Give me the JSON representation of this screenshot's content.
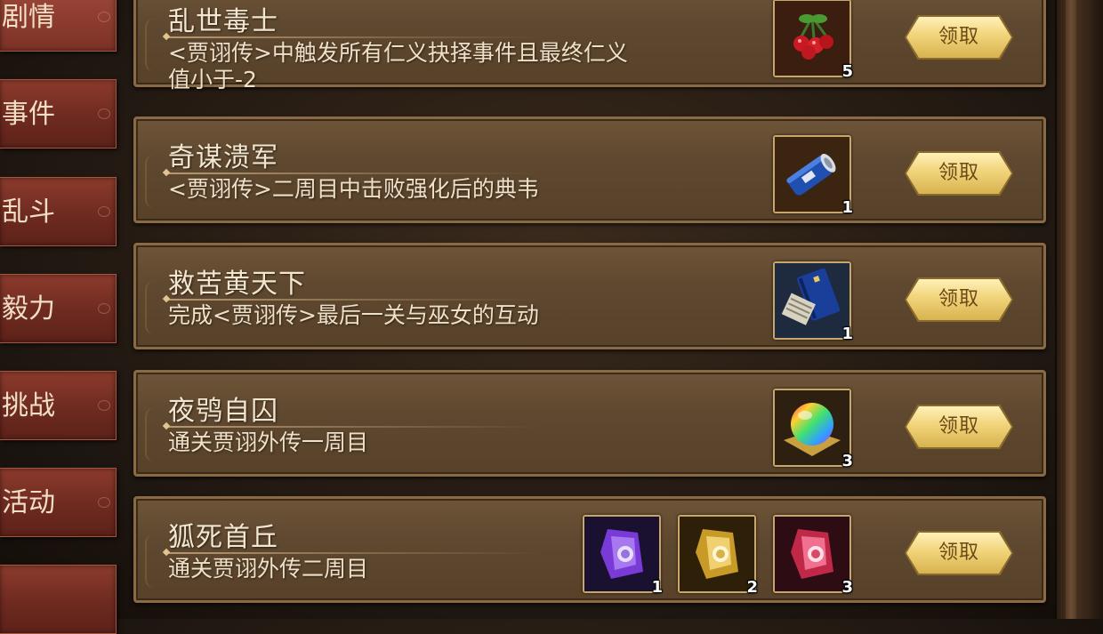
{
  "tabs": [
    {
      "label": "剧情",
      "active": true
    },
    {
      "label": "事件",
      "active": false
    },
    {
      "label": "乱斗",
      "active": false
    },
    {
      "label": "毅力",
      "active": false
    },
    {
      "label": "挑战",
      "active": false
    },
    {
      "label": "活动",
      "active": false
    },
    {
      "label": "",
      "active": false
    }
  ],
  "achievements": [
    {
      "title": "乱世毒士",
      "description": "<贾诩传>中触发所有仁义抉择事件且最终仁义值小于-2",
      "claim_label": "领取",
      "rewards": [
        {
          "icon": "cherry-icon",
          "count": "5"
        }
      ]
    },
    {
      "title": "奇谋溃军",
      "description": "<贾诩传>二周目中击败强化后的典韦",
      "claim_label": "领取",
      "rewards": [
        {
          "icon": "blue-scroll-icon",
          "count": "1"
        }
      ]
    },
    {
      "title": "救苦黄天下",
      "description": "完成<贾诩传>最后一关与巫女的互动",
      "claim_label": "领取",
      "rewards": [
        {
          "icon": "blue-book-icon",
          "count": "1"
        }
      ]
    },
    {
      "title": "夜鸮自囚",
      "description": "通关贾诩外传一周目",
      "claim_label": "领取",
      "rewards": [
        {
          "icon": "rainbow-orb-icon",
          "count": "3"
        }
      ]
    },
    {
      "title": "狐死首丘",
      "description": "通关贾诩外传二周目",
      "claim_label": "领取",
      "rewards": [
        {
          "icon": "purple-gem-icon",
          "count": "1"
        },
        {
          "icon": "gold-gem-icon",
          "count": "2"
        },
        {
          "icon": "red-gem-icon",
          "count": "3"
        }
      ]
    }
  ],
  "colors": {
    "tab": "#7c3226",
    "card": "#5f4830",
    "claim_button": "#f1d47a",
    "text": "#f3e6cf"
  }
}
